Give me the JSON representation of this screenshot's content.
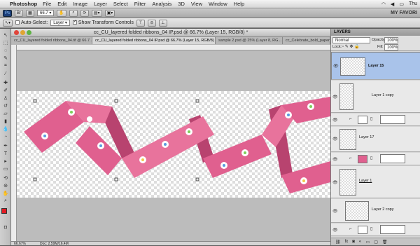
{
  "menubar": {
    "app_name": "Photoshop",
    "items": [
      "File",
      "Edit",
      "Image",
      "Layer",
      "Select",
      "Filter",
      "Analysis",
      "3D",
      "View",
      "Window",
      "Help"
    ],
    "clock": "Thu"
  },
  "appbar": {
    "zoom_value": "66.7",
    "workspace_label": "MY FAVORI"
  },
  "options": {
    "auto_select_label": "Auto-Select:",
    "auto_select_value": "Layer",
    "show_transform_label": "Show Transform Controls"
  },
  "document": {
    "title": "cc_CU_layered folded ribbons_04 IP.psd @ 66.7% (Layer 15, RGB/8) *",
    "tabs": [
      "cc_CU_layered folded ribbons_04.tif @ 66.7...",
      "cc_CU_layered folded ribbons_04 IP.psd @ 66.7% (Layer 15, RGB/8) *",
      "sample 2.psd @ 25% (Layer 8, RG...",
      "cc_Celebrate_bold_paper"
    ],
    "status_zoom": "66.67%",
    "status_doc": "Doc: 2.59M/16.4M"
  },
  "layers_panel": {
    "panel_title": "LAYERS",
    "blend_mode": "Normal",
    "opacity_label": "Opacity:",
    "opacity_value": "100%",
    "lock_label": "Lock:",
    "fill_label": "Fill:",
    "fill_value": "100%",
    "layers": [
      {
        "name": "Layer 15",
        "selected": true
      },
      {
        "name": "Layer 1 copy",
        "selected": false
      },
      {
        "name": "Layer 17",
        "selected": false
      },
      {
        "name": "Layer 1",
        "selected": false
      },
      {
        "name": "Layer 2 copy",
        "selected": false
      }
    ]
  },
  "colors": {
    "ribbon": "#e0608f",
    "ribbon_dark": "#b8436f",
    "foreground": "#e21b23",
    "selected_layer": "#a9c3ea"
  }
}
